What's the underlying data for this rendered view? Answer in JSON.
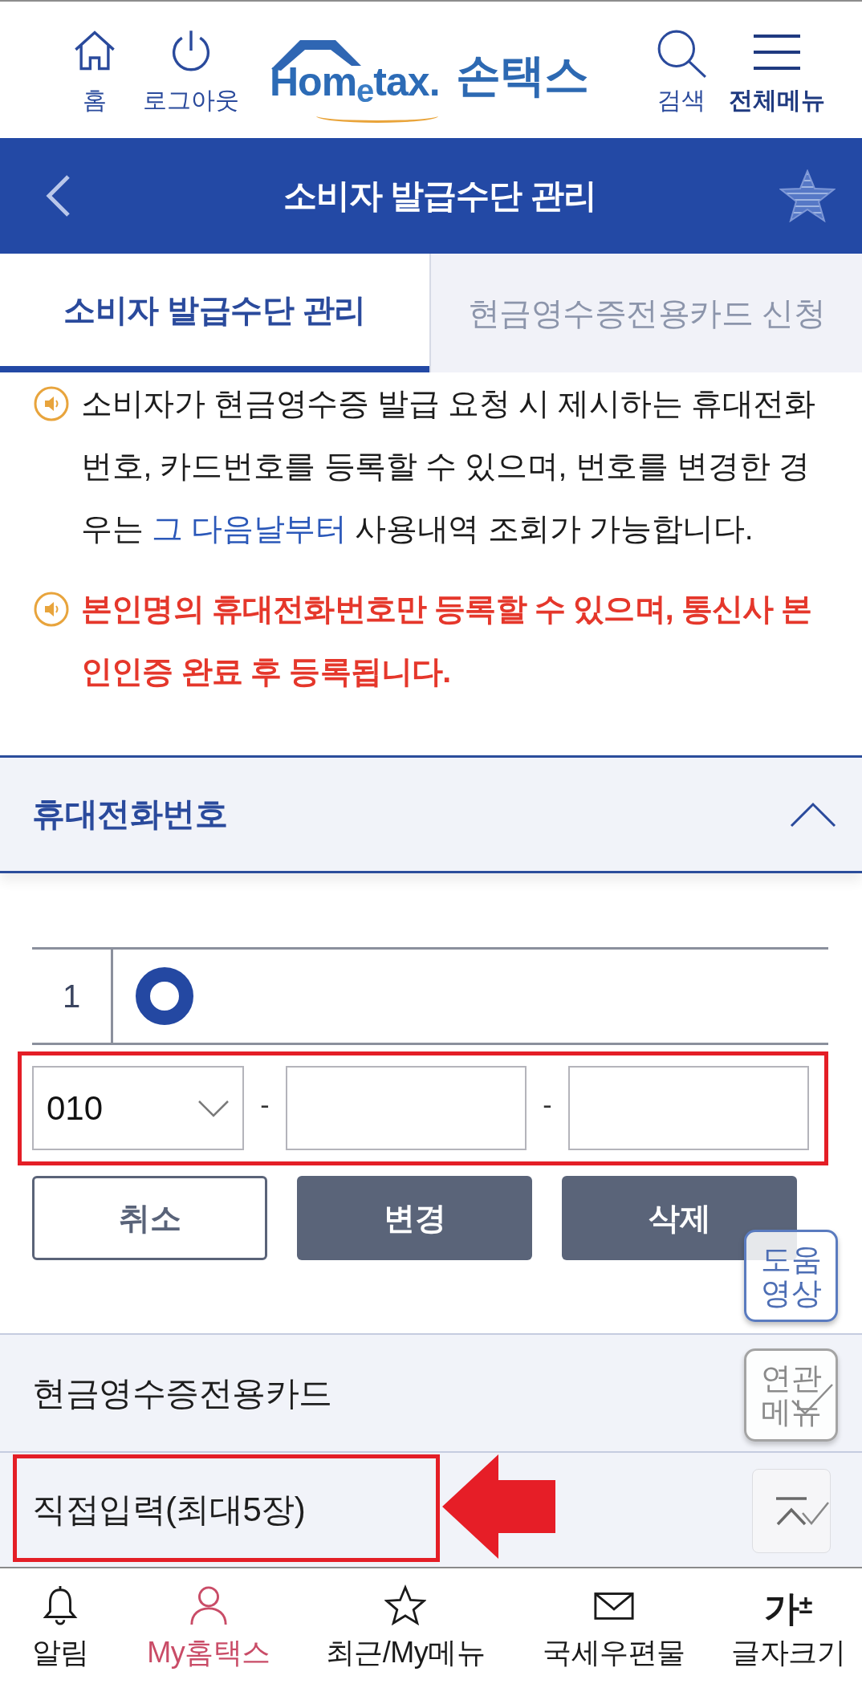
{
  "header": {
    "left": [
      {
        "kind": "home",
        "label": "홈",
        "bold": false
      },
      {
        "kind": "power",
        "label": "로그아웃",
        "bold": false
      }
    ],
    "logo": {
      "wordmark": "Hom$_{e}$tax.",
      "app_name": "손택스"
    },
    "right": [
      {
        "kind": "search",
        "label": "검색",
        "bold": false
      },
      {
        "kind": "menu",
        "label": "전체메뉴",
        "bold": true
      }
    ]
  },
  "title_bar": {
    "title": "소비자 발급수단 관리"
  },
  "tabs": [
    {
      "label": "소비자 발급수단 관리",
      "selected": true
    },
    {
      "label": "현금영수증전용카드 신청",
      "selected": false
    }
  ],
  "notices": [
    {
      "kind": "info",
      "text": "소비자가 현금영수증 발급 요청 시 제시하는 휴대전화번호, 카드번호를 등록할 수 있으며, 번호를 변경한 경우는 ",
      "highlight": "그 다음날부터",
      "text_after": " 사용내역 조회가 가능합니다."
    },
    {
      "kind": "warning",
      "text": "본인명의 휴대전화번호만 등록할 수 있으며, 통신사 본인인증 완료 후 등록됩니다."
    }
  ],
  "phone_section": {
    "title": "휴대전화번호",
    "expanded": true,
    "entries": [
      {
        "number": "1",
        "selected": true
      }
    ],
    "input": {
      "highlighted": true,
      "parts": [
        {
          "kind": "select",
          "value": "010"
        },
        {
          "kind": "separator",
          "text": "-"
        },
        {
          "kind": "input"
        },
        {
          "kind": "separator",
          "text": "-"
        },
        {
          "kind": "input"
        }
      ]
    },
    "buttons": [
      {
        "kind": "outline",
        "label": "취소"
      },
      {
        "kind": "filled",
        "label": "변경"
      },
      {
        "kind": "filled",
        "label": "삭제"
      }
    ]
  },
  "card_section": {
    "items": [
      {
        "label": "현금영수증전용카드",
        "highlighted": false,
        "pointer_arrow": false
      },
      {
        "label": "직접입력(최대5장)",
        "highlighted": true,
        "pointer_arrow": true
      }
    ]
  },
  "floating_buttons": [
    {
      "kind": "help_video",
      "label": "도움영상"
    },
    {
      "kind": "related_menu",
      "label": "연관메뉴"
    },
    {
      "kind": "scroll_top"
    }
  ],
  "bottom_nav": [
    {
      "kind": "bell",
      "label": "알림",
      "selected": false
    },
    {
      "kind": "person",
      "label": "My홈택스",
      "selected": true
    },
    {
      "kind": "star",
      "label": "최근/My메뉴",
      "selected": false
    },
    {
      "kind": "mail",
      "label": "국세우편물",
      "selected": false
    },
    {
      "kind": "glyph",
      "glyph": "가$^{±}$",
      "label": "글자크기",
      "selected": false
    }
  ]
}
